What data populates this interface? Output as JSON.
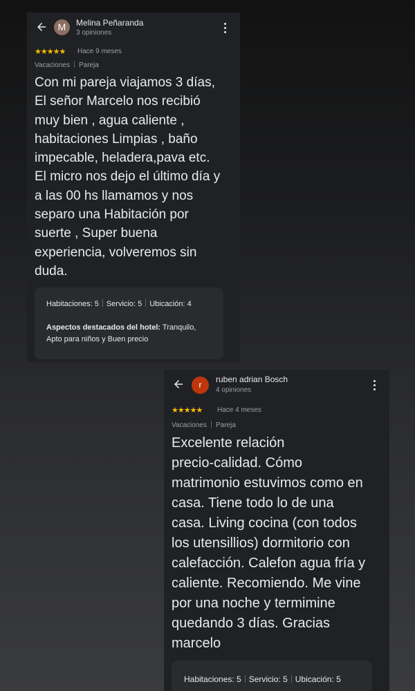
{
  "reviews": [
    {
      "author": "Melina Peñaranda",
      "avatar_letter": "M",
      "avatar_color": "#8d6e63",
      "review_count": "3 opiniones",
      "stars": "★★★★★",
      "time_ago": "Hace 9 meses",
      "trip_type": "Vacaciones",
      "companions": "Pareja",
      "text": "Con mi pareja viajamos 3 días,\nEl señor Marcelo nos recibió\nmuy bien , agua caliente ,\nhabitaciones Limpias , baño\nimpecable,  heladera,pava etc.\nEl micro nos dejo el último día y\na las 00 hs llamamos y nos\nseparo una Habitación por\nsuerte , Super buena\nexperiencia, volveremos sin\nduda.",
      "ratings": {
        "rooms": "Habitaciones: 5",
        "service": "Servicio: 5",
        "location": "Ubicación: 4"
      },
      "highlights_label": "Aspectos destacados del hotel:",
      "highlights_value": "Tranquilo,\nApto para niños y Buen precio"
    },
    {
      "author": "ruben adrian Bosch",
      "avatar_letter": "r",
      "avatar_color": "#bf360c",
      "review_count": "4 opiniones",
      "stars": "★★★★★",
      "time_ago": "Hace 4 meses",
      "trip_type": "Vacaciones",
      "companions": "Pareja",
      "text": "Excelente relación\nprecio-calidad. Cómo\nmatrimonio estuvimos como en\ncasa. Tiene todo lo de una\ncasa. Living cocina (con todos\nlos utensillios) dormitorio con\ncalefacción. Calefon agua fría y\ncaliente. Recomiendo. Me vine\npor una noche y termimine\nquedando 3 días. Gracias\nmarcelo",
      "ratings": {
        "rooms": "Habitaciones: 5",
        "service": "Servicio: 5",
        "location": "Ubicación: 5"
      }
    }
  ],
  "icons": {
    "back": "arrow-back-icon",
    "more": "more-vert-icon",
    "star": "star-icon"
  },
  "colors": {
    "star": "#fbbc04",
    "card_bg": "#202124",
    "text": "#e8eaed",
    "muted": "#9aa0a6"
  }
}
